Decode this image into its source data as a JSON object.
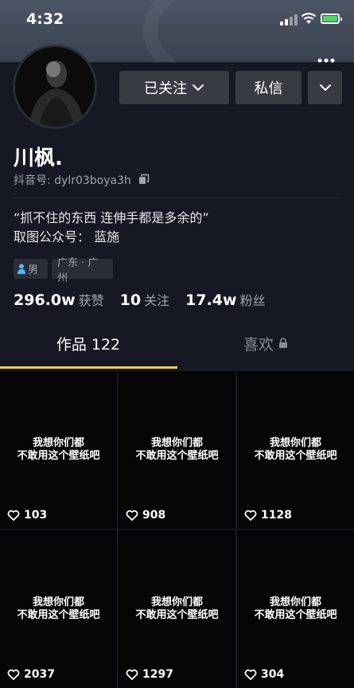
{
  "status_bar": {
    "time": "4:32"
  },
  "profile": {
    "nickname": "川枫.",
    "douyin_id": "抖音号: dylr03boya3h",
    "bio_line1": "“抓不住的东西 连伸手都是多余的”",
    "bio_line2": "取图公众号：  蓝施",
    "gender_tag": "男",
    "location_tag": "广东 · 广州"
  },
  "buttons": {
    "follow": "已关注",
    "message": "私信"
  },
  "stats": [
    {
      "num": "296.0w",
      "label": "获赞"
    },
    {
      "num": "10",
      "label": "关注"
    },
    {
      "num": "17.4w",
      "label": "粉丝"
    }
  ],
  "tabs": {
    "works": "作品 122",
    "likes": "喜欢"
  },
  "videos": [
    {
      "caption_line1": "我想你们都",
      "caption_line2": "不敢用这个壁纸吧",
      "likes": "103"
    },
    {
      "caption_line1": "我想你们都",
      "caption_line2": "不敢用这个壁纸吧",
      "likes": "908"
    },
    {
      "caption_line1": "我想你们都",
      "caption_line2": "不敢用这个壁纸吧",
      "likes": "1128"
    },
    {
      "caption_line1": "我想你们都",
      "caption_line2": "不敢用这个壁纸吧",
      "likes": "2037"
    },
    {
      "caption_line1": "我想你们都",
      "caption_line2": "不敢用这个壁纸吧",
      "likes": "1297"
    },
    {
      "caption_line1": "我想你们都",
      "caption_line2": "不敢用这个壁纸吧",
      "likes": "304"
    }
  ],
  "colors": {
    "tab_accent": "#facd52",
    "battery": "#4cd964",
    "gender_icon": "#52b7f5"
  }
}
